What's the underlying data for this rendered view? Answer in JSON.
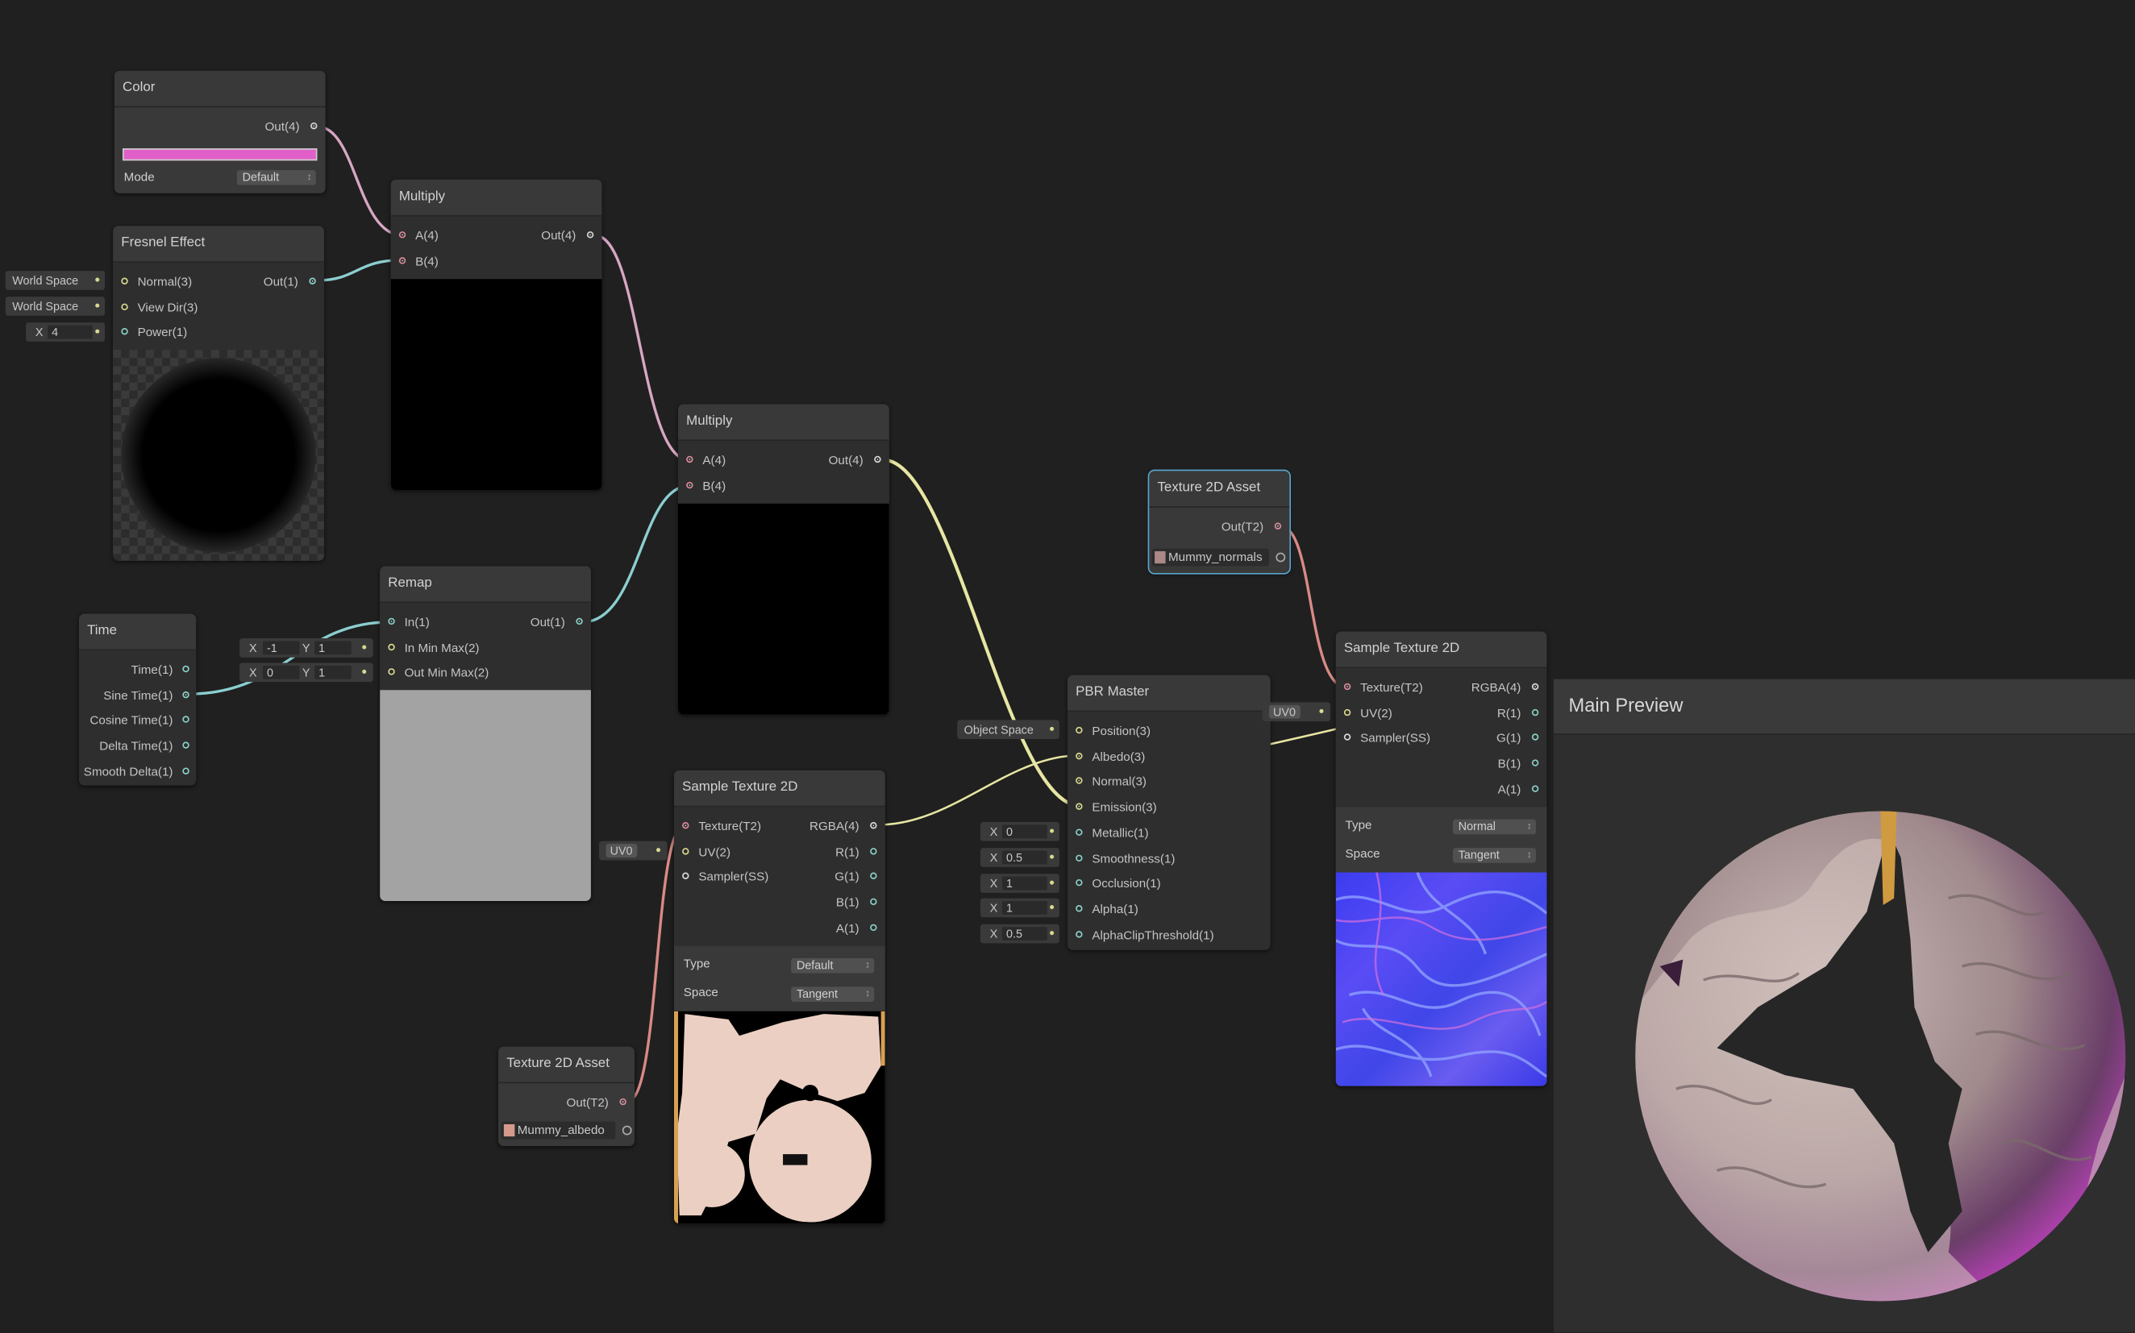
{
  "nodes": {
    "color": {
      "title": "Color",
      "out": "Out(4)",
      "swatch": "#e05fc8",
      "mode_label": "Mode",
      "mode_value": "Default"
    },
    "fresnel": {
      "title": "Fresnel Effect",
      "inputs": [
        "Normal(3)",
        "View Dir(3)",
        "Power(1)"
      ],
      "out": "Out(1)",
      "normal_space": "World Space",
      "viewdir_space": "World Space",
      "power_x_label": "X",
      "power_value": "4"
    },
    "multiply1": {
      "title": "Multiply",
      "a": "A(4)",
      "b": "B(4)",
      "out": "Out(4)"
    },
    "multiply2": {
      "title": "Multiply",
      "a": "A(4)",
      "b": "B(4)",
      "out": "Out(4)"
    },
    "time": {
      "title": "Time",
      "outputs": [
        "Time(1)",
        "Sine Time(1)",
        "Cosine Time(1)",
        "Delta Time(1)",
        "Smooth Delta(1)"
      ]
    },
    "remap": {
      "title": "Remap",
      "inputs": [
        "In(1)",
        "In Min Max(2)",
        "Out Min Max(2)"
      ],
      "out": "Out(1)",
      "inminmax": {
        "x_label": "X",
        "x": "-1",
        "y_label": "Y",
        "y": "1"
      },
      "outminmax": {
        "x_label": "X",
        "x": "0",
        "y_label": "Y",
        "y": "1"
      }
    },
    "sample1": {
      "title": "Sample Texture 2D",
      "inputs": [
        "Texture(T2)",
        "UV(2)",
        "Sampler(SS)"
      ],
      "outputs": [
        "RGBA(4)",
        "R(1)",
        "G(1)",
        "B(1)",
        "A(1)"
      ],
      "uv_value": "UV0",
      "type_label": "Type",
      "type_value": "Default",
      "space_label": "Space",
      "space_value": "Tangent"
    },
    "asset1": {
      "title": "Texture 2D Asset",
      "out": "Out(T2)",
      "asset": "Mummy_albedo"
    },
    "asset2": {
      "title": "Texture 2D Asset",
      "out": "Out(T2)",
      "asset": "Mummy_normals"
    },
    "pbr": {
      "title": "PBR Master",
      "inputs": [
        "Position(3)",
        "Albedo(3)",
        "Normal(3)",
        "Emission(3)",
        "Metallic(1)",
        "Smoothness(1)",
        "Occlusion(1)",
        "Alpha(1)",
        "AlphaClipThreshold(1)"
      ],
      "position_space": "Object Space",
      "x_label": "X",
      "metallic": "0",
      "smoothness": "0.5",
      "occlusion": "1",
      "alpha": "1",
      "alpha_clip": "0.5"
    },
    "sample2": {
      "title": "Sample Texture 2D",
      "inputs": [
        "Texture(T2)",
        "UV(2)",
        "Sampler(SS)"
      ],
      "outputs": [
        "RGBA(4)",
        "R(1)",
        "G(1)",
        "B(1)",
        "A(1)"
      ],
      "uv_value": "UV0",
      "type_label": "Type",
      "type_value": "Normal",
      "space_label": "Space",
      "space_value": "Tangent"
    }
  },
  "main_preview": {
    "title": "Main Preview"
  },
  "colors": {
    "background": "#202020",
    "wire_pink": "#d7a6c4",
    "wire_cyan": "#8ccfd0",
    "wire_yellow": "#e7e6a3",
    "wire_texture": "#d98a86",
    "selection": "#5aa6cf"
  }
}
